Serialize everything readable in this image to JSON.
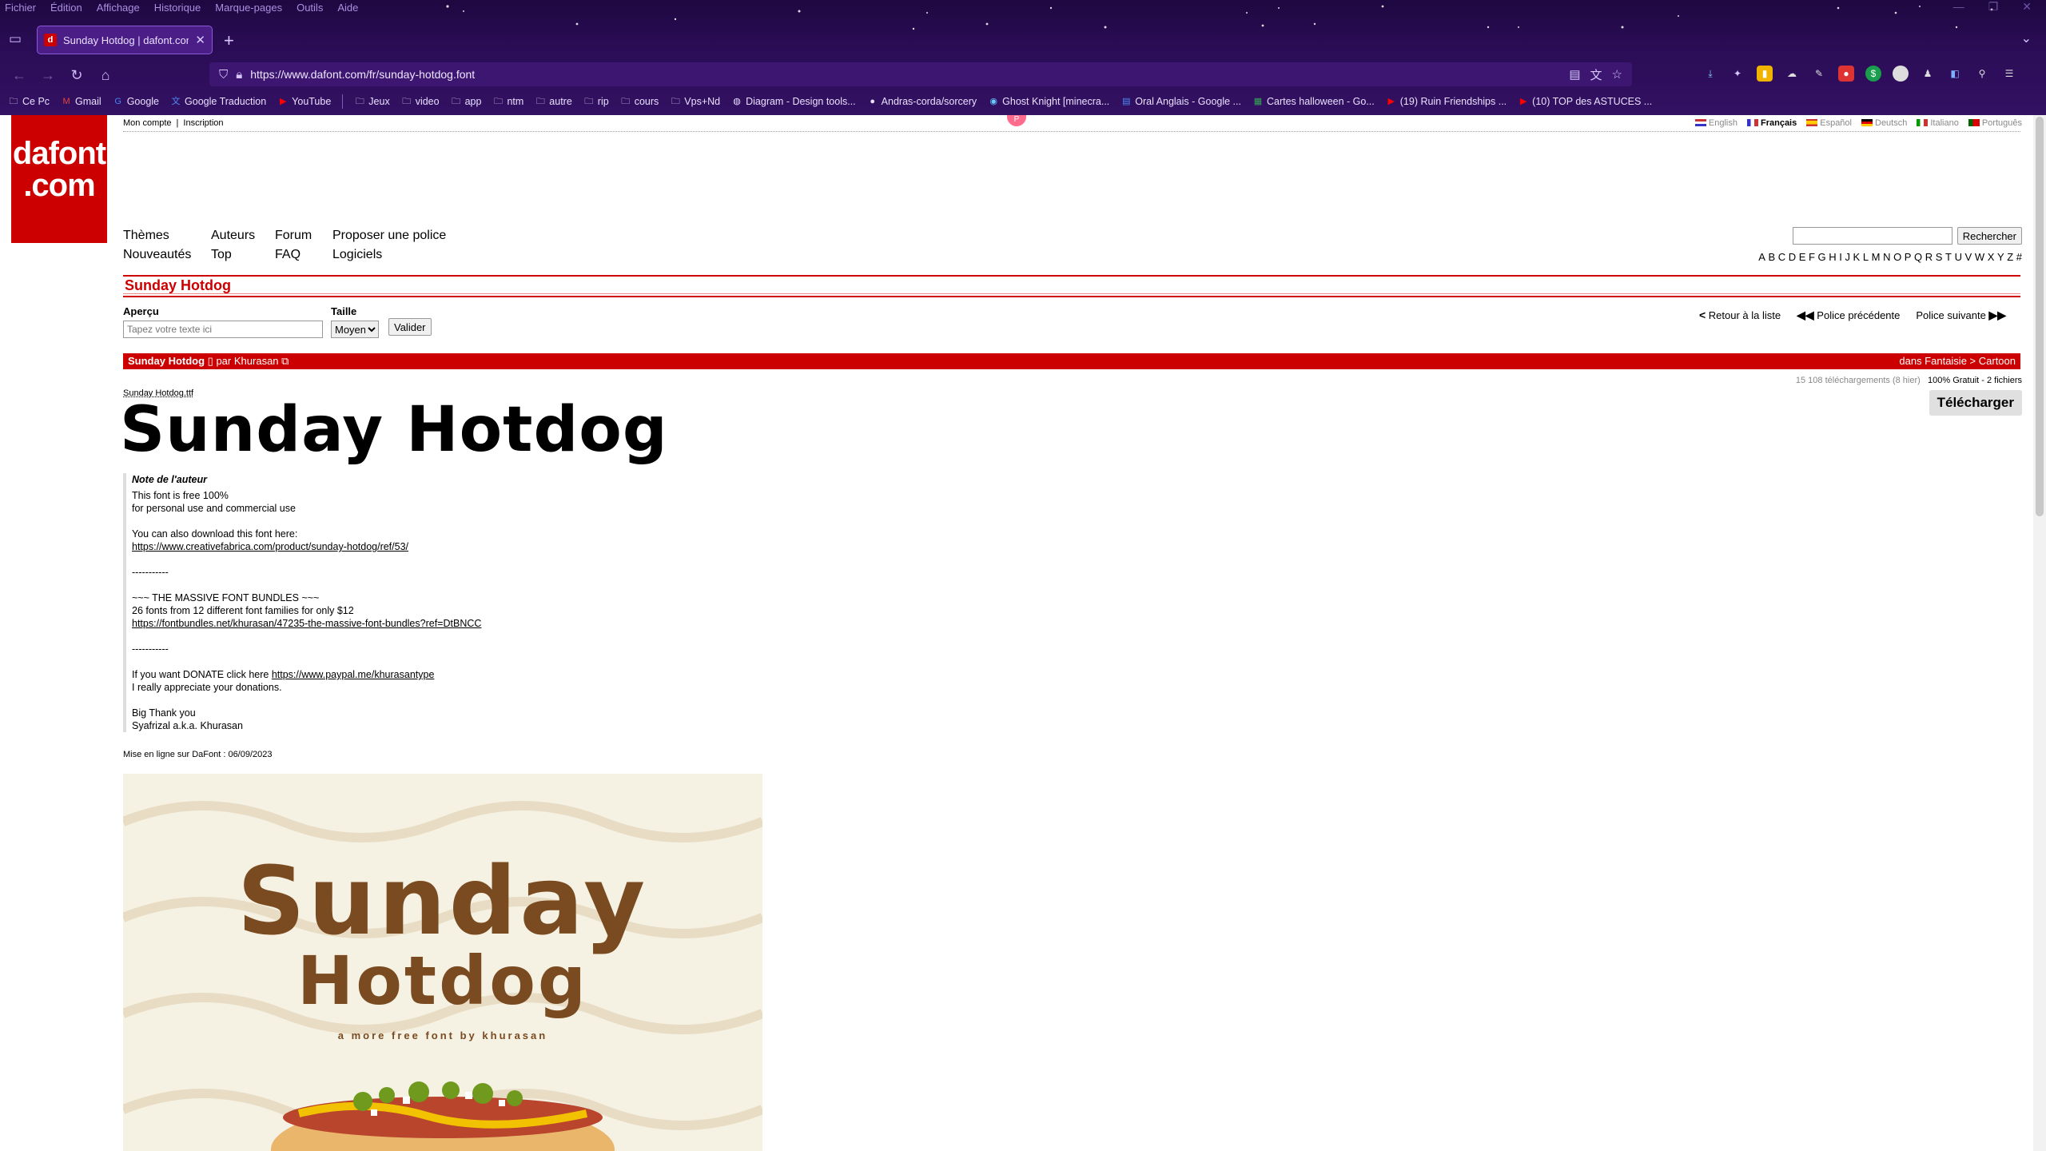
{
  "browser": {
    "menu": [
      "Fichier",
      "Édition",
      "Affichage",
      "Historique",
      "Marque-pages",
      "Outils",
      "Aide"
    ],
    "tab_title": "Sunday Hotdog | dafont.com",
    "url": "https://www.dafont.com/fr/sunday-hotdog.font",
    "bookmarks": [
      "Ce Pc",
      "Gmail",
      "Google",
      "Google Traduction",
      "YouTube",
      "Jeux",
      "video",
      "app",
      "ntm",
      "autre",
      "rip",
      "cours",
      "Vps+Nd",
      "Diagram - Design tools...",
      "Andras-corda/sorcery",
      "Ghost Knight [minecra...",
      "Oral Anglais - Google ...",
      "Cartes halloween - Go...",
      "(19) Ruin Friendships ...",
      "(10) TOP des ASTUCES ..."
    ]
  },
  "site": {
    "logo_line1": "dafont",
    "logo_line2": ".com",
    "account": "Mon compte",
    "signup": "Inscription",
    "languages": [
      "English",
      "Français",
      "Español",
      "Deutsch",
      "Italiano",
      "Português"
    ],
    "nav": [
      "Thèmes",
      "Auteurs",
      "Forum",
      "Proposer une police",
      "Nouveautés",
      "Top",
      "FAQ",
      "Logiciels"
    ],
    "search_button": "Rechercher",
    "alphabet": [
      "A",
      "B",
      "C",
      "D",
      "E",
      "F",
      "G",
      "H",
      "I",
      "J",
      "K",
      "L",
      "M",
      "N",
      "O",
      "P",
      "Q",
      "R",
      "S",
      "T",
      "U",
      "V",
      "W",
      "X",
      "Y",
      "Z",
      "#"
    ]
  },
  "font": {
    "title": "Sunday Hotdog",
    "preview_label": "Aperçu",
    "preview_placeholder": "Tapez votre texte ici",
    "size_label": "Taille",
    "size_value": "Moyen",
    "validate": "Valider",
    "back": "Retour à la liste",
    "prev": "Police précédente",
    "next": "Police suivante",
    "name": "Sunday Hotdog",
    "by": "par",
    "author": "Khurasan",
    "category": "dans Fantaisie > Cartoon",
    "downloads": "15 108 téléchargements (8 hier)",
    "license": "100% Gratuit - 2 fichiers",
    "file": "Sunday Hotdog.ttf",
    "preview_text": "Sunday Hotdog",
    "download": "Télécharger",
    "note_title": "Note de l'auteur",
    "note_lines": [
      "This font is free 100%",
      "for personal use and commercial use",
      "",
      "You can also download this font here:",
      "",
      "",
      "-----------",
      "",
      "~~~ THE MASSIVE FONT BUNDLES ~~~",
      "26 fonts from 12 different font families for only $12",
      "",
      "",
      "-----------",
      "",
      "If you want DONATE click here ",
      "I really appreciate your donations.",
      "",
      "Big Thank you",
      "Syafrizal a.k.a. Khurasan"
    ],
    "link1": "https://www.creativefabrica.com/product/sunday-hotdog/ref/53/",
    "link2": "https://fontbundles.net/khurasan/47235-the-massive-font-bundles?ref=DtBNCC",
    "link3": "https://www.paypal.me/khurasantype",
    "online": "Mise en ligne sur DaFont : 06/09/2023",
    "banner_line1": "Sunday",
    "banner_line2": "Hotdog",
    "banner_line3": "a more free font by khurasan"
  },
  "colors": {
    "accent": "#cc0000",
    "chrome": "#2a0c55"
  }
}
